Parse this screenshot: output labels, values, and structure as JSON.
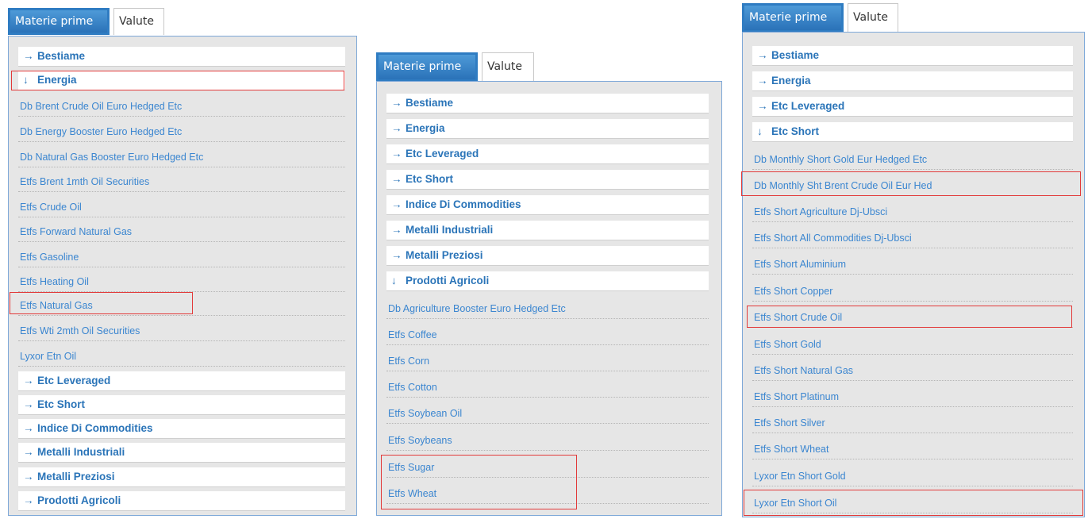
{
  "tabs": {
    "commodities": "Materie prime",
    "currencies": "Valute"
  },
  "arrows": {
    "collapsed": "→",
    "expanded": "↓"
  },
  "panel1": {
    "sections_top": [
      "Bestiame",
      "Energia"
    ],
    "energia_items": [
      "Db Brent Crude Oil Euro Hedged Etc",
      "Db Energy Booster Euro Hedged Etc",
      "Db Natural Gas Booster Euro Hedged Etc",
      "Etfs Brent 1mth Oil Securities",
      "Etfs Crude Oil",
      "Etfs Forward Natural Gas",
      "Etfs Gasoline",
      "Etfs Heating Oil",
      "Etfs Natural Gas",
      "Etfs Wti 2mth Oil Securities",
      "Lyxor Etn Oil"
    ],
    "sections_bottom": [
      "Etc Leveraged",
      "Etc Short",
      "Indice Di Commodities",
      "Metalli Industriali",
      "Metalli Preziosi",
      "Prodotti Agricoli"
    ]
  },
  "panel2": {
    "sections": [
      "Bestiame",
      "Energia",
      "Etc Leveraged",
      "Etc Short",
      "Indice Di Commodities",
      "Metalli Industriali",
      "Metalli Preziosi",
      "Prodotti Agricoli"
    ],
    "agricoli_items": [
      "Db Agriculture Booster Euro Hedged Etc",
      "Etfs Coffee",
      "Etfs Corn",
      "Etfs Cotton",
      "Etfs Soybean Oil",
      "Etfs Soybeans",
      "Etfs Sugar",
      "Etfs Wheat"
    ]
  },
  "panel3": {
    "sections": [
      "Bestiame",
      "Energia",
      "Etc Leveraged",
      "Etc Short"
    ],
    "short_items": [
      "Db Monthly Short Gold Eur Hedged Etc",
      "Db Monthly Sht Brent Crude Oil Eur Hed",
      "Etfs Short Agriculture Dj-Ubsci",
      "Etfs Short All Commodities Dj-Ubsci",
      "Etfs Short Aluminium",
      "Etfs Short Copper",
      "Etfs Short Crude Oil",
      "Etfs Short Gold",
      "Etfs Short Natural Gas",
      "Etfs Short Platinum",
      "Etfs Short Silver",
      "Etfs Short Wheat",
      "Lyxor Etn Short Gold",
      "Lyxor Etn Short Oil"
    ]
  },
  "colors": {
    "tab_active": "#2a72b8",
    "link": "#3b86d0",
    "highlight": "#e23a3a",
    "panel_bg": "#e6e6e6"
  }
}
